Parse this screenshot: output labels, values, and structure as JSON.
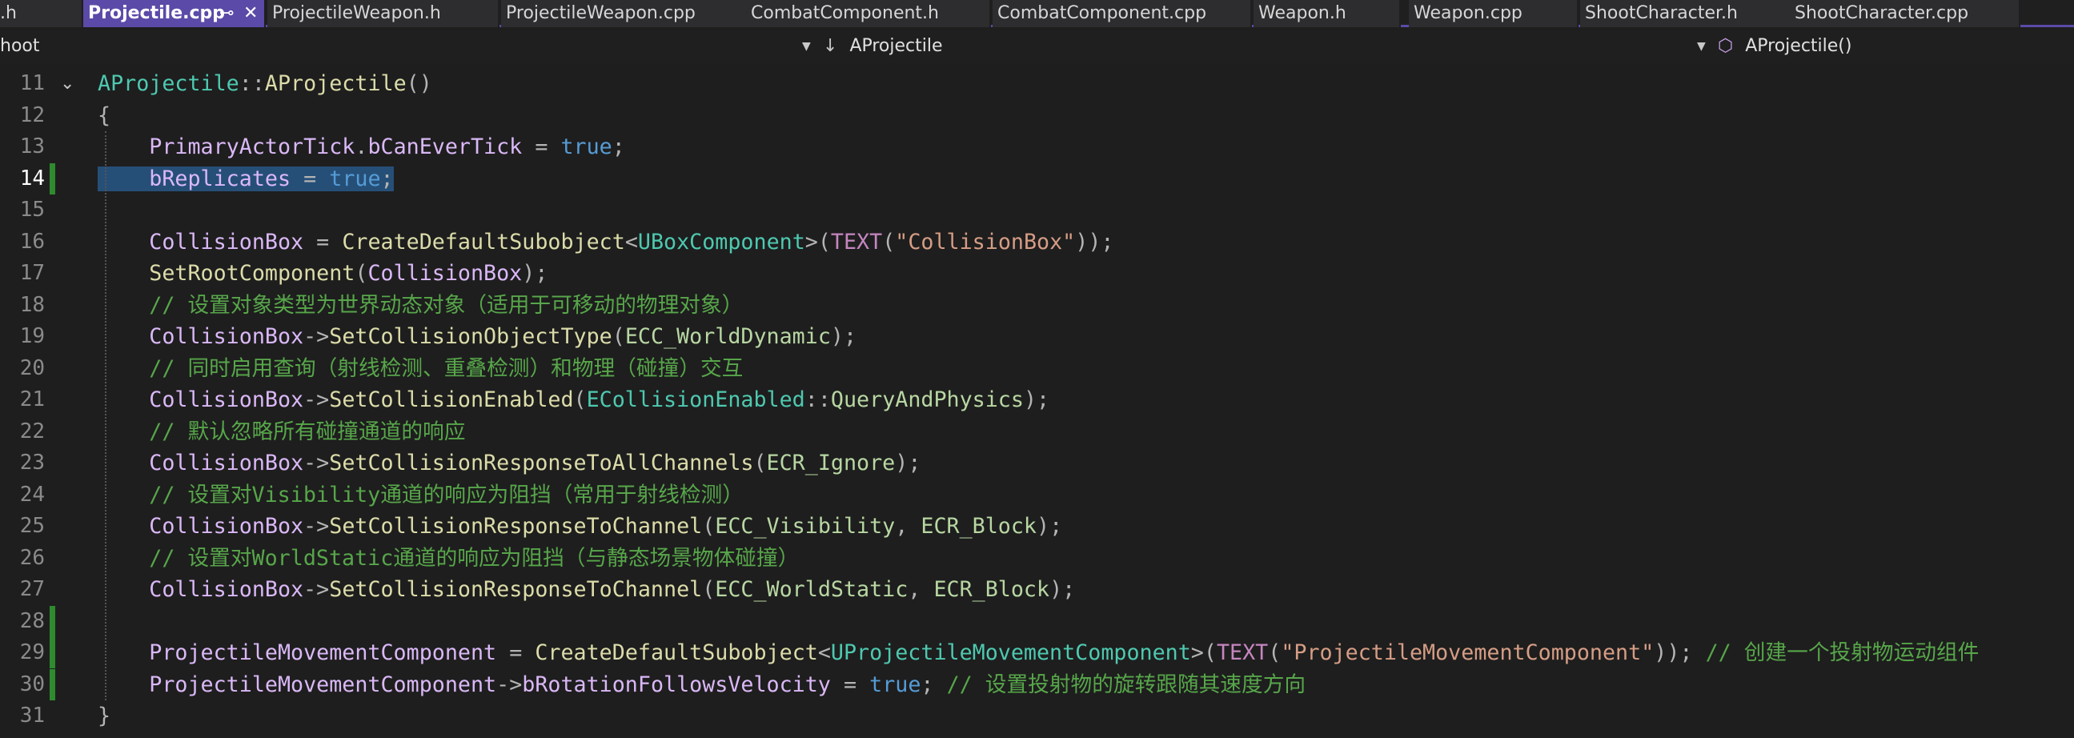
{
  "tabs": [
    {
      "label": ".h",
      "active": false
    },
    {
      "label": "Projectile.cpp",
      "active": true
    },
    {
      "label": "ProjectileWeapon.h",
      "active": false
    },
    {
      "label": "ProjectileWeapon.cpp",
      "active": false
    },
    {
      "label": "CombatComponent.h",
      "active": false
    },
    {
      "label": "CombatComponent.cpp",
      "active": false
    },
    {
      "label": "Weapon.h",
      "active": false
    },
    {
      "label": "Weapon.cpp",
      "active": false
    },
    {
      "label": "ShootCharacter.h",
      "active": false
    },
    {
      "label": "ShootCharacter.cpp",
      "active": false
    }
  ],
  "tab_glyphs": {
    "pin": "⊸",
    "close": "✕"
  },
  "navbar": {
    "project": "hoot",
    "type_scope": "AProjectile",
    "member_scope": "AProjectile()",
    "type_icon": "↓",
    "member_icon": "⬡",
    "dropdown_icon": "▼"
  },
  "editor": {
    "current_line": 14,
    "fold_icon": "⌄",
    "lines": [
      {
        "n": "11",
        "text": "AProjectile::AProjectile()"
      },
      {
        "n": "12",
        "text": "{"
      },
      {
        "n": "13",
        "text": "    PrimaryActorTick.bCanEverTick = true;"
      },
      {
        "n": "14",
        "text": "    bReplicates = true;"
      },
      {
        "n": "15",
        "text": ""
      },
      {
        "n": "16",
        "text": "    CollisionBox = CreateDefaultSubobject<UBoxComponent>(TEXT(\"CollisionBox\"));"
      },
      {
        "n": "17",
        "text": "    SetRootComponent(CollisionBox);"
      },
      {
        "n": "18",
        "text": "    // 设置对象类型为世界动态对象（适用于可移动的物理对象）"
      },
      {
        "n": "19",
        "text": "    CollisionBox->SetCollisionObjectType(ECC_WorldDynamic);"
      },
      {
        "n": "20",
        "text": "    // 同时启用查询（射线检测、重叠检测）和物理（碰撞）交互"
      },
      {
        "n": "21",
        "text": "    CollisionBox->SetCollisionEnabled(ECollisionEnabled::QueryAndPhysics);"
      },
      {
        "n": "22",
        "text": "    // 默认忽略所有碰撞通道的响应"
      },
      {
        "n": "23",
        "text": "    CollisionBox->SetCollisionResponseToAllChannels(ECR_Ignore);"
      },
      {
        "n": "24",
        "text": "    // 设置对Visibility通道的响应为阻挡（常用于射线检测）"
      },
      {
        "n": "25",
        "text": "    CollisionBox->SetCollisionResponseToChannel(ECC_Visibility, ECR_Block);"
      },
      {
        "n": "26",
        "text": "    // 设置对WorldStatic通道的响应为阻挡（与静态场景物体碰撞）"
      },
      {
        "n": "27",
        "text": "    CollisionBox->SetCollisionResponseToChannel(ECC_WorldStatic, ECR_Block);"
      },
      {
        "n": "28",
        "text": ""
      },
      {
        "n": "29",
        "text": "    ProjectileMovementComponent = CreateDefaultSubobject<UProjectileMovementComponent>(TEXT(\"ProjectileMovementComponent\")); // 创建一个投射物运动组件"
      },
      {
        "n": "30",
        "text": "    ProjectileMovementComponent->bRotationFollowsVelocity = true; // 设置投射物的旋转跟随其速度方向"
      },
      {
        "n": "31",
        "text": "}"
      }
    ]
  },
  "colors": {
    "accent": "#5b4aa8",
    "change_indicator": "#2e8b2e",
    "selection": "#264f78"
  }
}
